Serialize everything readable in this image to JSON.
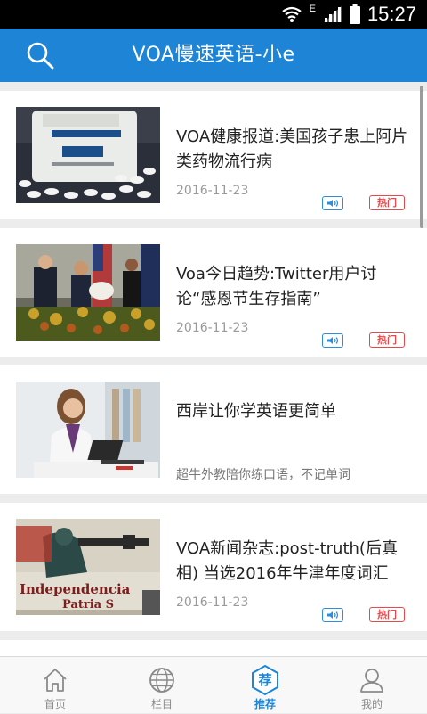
{
  "status_bar": {
    "time": "15:27",
    "network_letter": "E"
  },
  "app_bar": {
    "title": "VOA慢速英语-小e",
    "search_icon": "search-icon"
  },
  "articles": [
    {
      "title": "VOA健康报道:美国孩子患上阿片类药物流行病",
      "date": "2016-11-23",
      "badge_hot": "热门",
      "thumbnail": "pill-bottle-image"
    },
    {
      "title": "Voa今日趋势:Twitter用户讨论“感恩节生存指南”",
      "date": "2016-11-23",
      "badge_hot": "热门",
      "thumbnail": "thanksgiving-turkey-image"
    },
    {
      "title": "VOA新闻杂志:post-truth(后真相) 当选2016年牛津年度词汇",
      "date": "2016-11-23",
      "badge_hot": "热门",
      "thumbnail": "independence-mural-image"
    }
  ],
  "ad": {
    "title": "西岸让你学英语更简单",
    "subtitle": "超牛外教陪你练口语，不记单词",
    "thumbnail": "student-laptop-image"
  },
  "bottom_nav": [
    {
      "label": "首页",
      "icon": "home-icon",
      "active": false
    },
    {
      "label": "栏目",
      "icon": "globe-icon",
      "active": false
    },
    {
      "label": "推荐",
      "icon": "recommend-icon",
      "glyph": "荐",
      "active": true
    },
    {
      "label": "我的",
      "icon": "profile-icon",
      "active": false
    }
  ],
  "colors": {
    "primary": "#1e85d6",
    "hot": "#e34b4b",
    "audio": "#2d8ddb",
    "background": "#ececec"
  }
}
